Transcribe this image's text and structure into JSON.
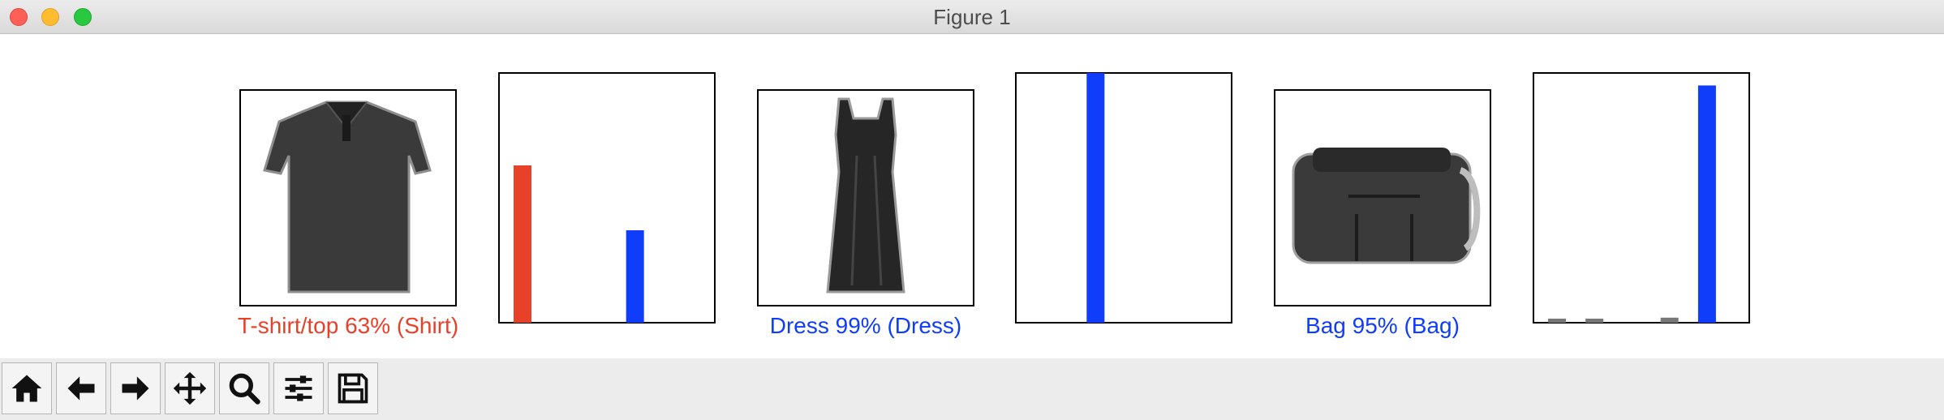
{
  "window": {
    "title": "Figure 1",
    "controls": [
      "close",
      "minimize",
      "zoom"
    ]
  },
  "figure": {
    "panels": [
      {
        "kind": "image",
        "icon": "tshirt-image",
        "caption": "T-shirt/top 63% (Shirt)",
        "caption_color": "#e8412a"
      },
      {
        "kind": "bar_chart",
        "chart_index": 0
      },
      {
        "kind": "image",
        "icon": "dress-image",
        "caption": "Dress 99% (Dress)",
        "caption_color": "#0f3dfa"
      },
      {
        "kind": "bar_chart",
        "chart_index": 1
      },
      {
        "kind": "image",
        "icon": "bag-image",
        "caption": "Bag 95% (Bag)",
        "caption_color": "#0f3dfa"
      },
      {
        "kind": "bar_chart",
        "chart_index": 2
      }
    ]
  },
  "chart_data": [
    {
      "type": "bar",
      "categories": [
        "0",
        "1",
        "2",
        "3",
        "4",
        "5",
        "6",
        "7",
        "8",
        "9"
      ],
      "values": [
        0.63,
        0.0,
        0.0,
        0.0,
        0.0,
        0.0,
        0.37,
        0.0,
        0.0,
        0.0
      ],
      "colors": [
        "#e8412a",
        "#777777",
        "#777777",
        "#777777",
        "#777777",
        "#777777",
        "#0f3dfa",
        "#777777",
        "#777777",
        "#777777"
      ],
      "ylim": [
        0,
        1
      ],
      "ticks": "none"
    },
    {
      "type": "bar",
      "categories": [
        "0",
        "1",
        "2",
        "3",
        "4",
        "5",
        "6",
        "7",
        "8",
        "9"
      ],
      "values": [
        0.0,
        0.0,
        0.0,
        1.0,
        0.0,
        0.0,
        0.0,
        0.0,
        0.0,
        0.0
      ],
      "colors": [
        "#777777",
        "#777777",
        "#777777",
        "#0f3dfa",
        "#777777",
        "#777777",
        "#777777",
        "#777777",
        "#777777",
        "#777777"
      ],
      "ylim": [
        0,
        1
      ],
      "ticks": "none"
    },
    {
      "type": "bar",
      "categories": [
        "0",
        "1",
        "2",
        "3",
        "4",
        "5",
        "6",
        "7",
        "8",
        "9"
      ],
      "values": [
        0.01,
        0.0,
        0.005,
        0.0,
        0.0,
        0.0,
        0.02,
        0.0,
        0.95,
        0.0
      ],
      "colors": [
        "#777777",
        "#777777",
        "#777777",
        "#777777",
        "#777777",
        "#777777",
        "#777777",
        "#777777",
        "#0f3dfa",
        "#777777"
      ],
      "ylim": [
        0,
        1
      ],
      "ticks": "none"
    }
  ],
  "toolbar": {
    "buttons": [
      {
        "name": "home-button",
        "icon": "home-icon"
      },
      {
        "name": "back-button",
        "icon": "arrow-left-icon"
      },
      {
        "name": "forward-button",
        "icon": "arrow-right-icon"
      },
      {
        "name": "pan-button",
        "icon": "move-icon"
      },
      {
        "name": "zoom-button",
        "icon": "magnifier-icon"
      },
      {
        "name": "configure-subplots-button",
        "icon": "sliders-icon"
      },
      {
        "name": "save-button",
        "icon": "floppy-disk-icon"
      }
    ]
  }
}
